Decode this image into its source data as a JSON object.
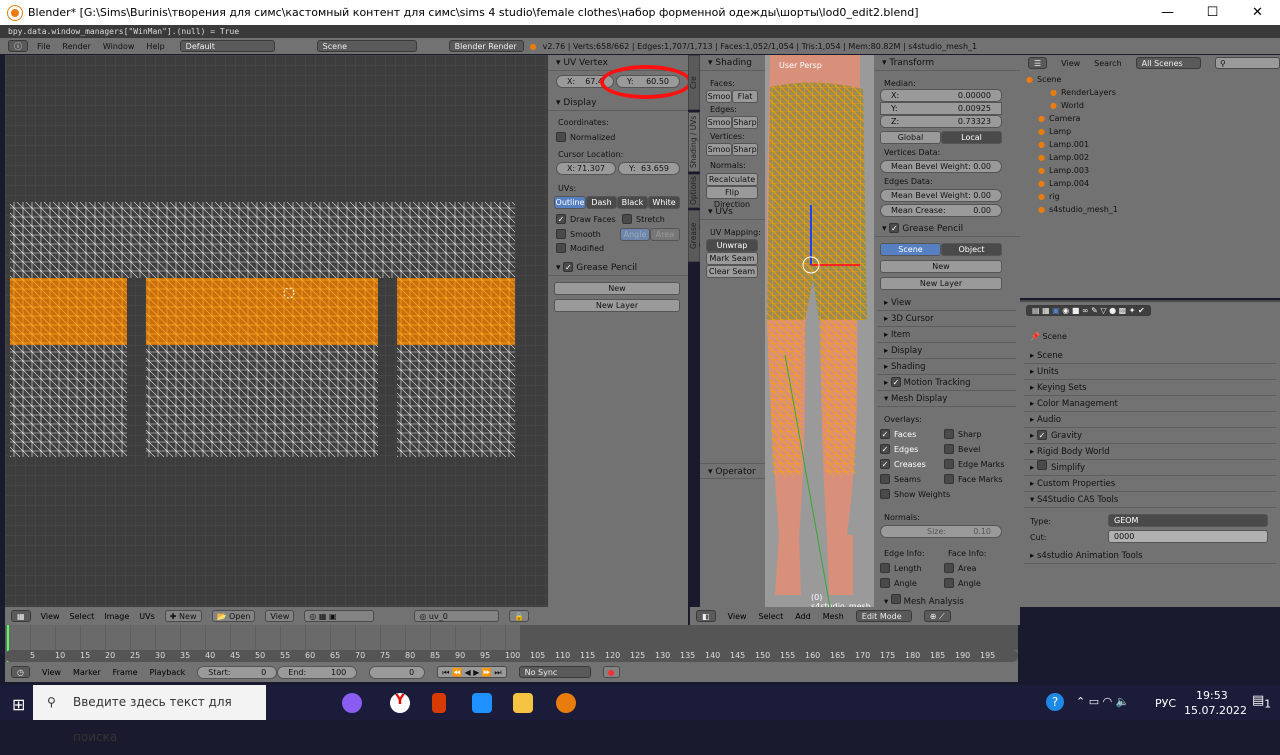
{
  "window": {
    "title": "Blender* [G:\\Sims\\Burinis\\творения для симс\\кастомный контент для симс\\sims 4 studio\\female clothes\\набор форменной одежды\\шорты\\lod0_edit2.blend]",
    "minimize": "—",
    "maximize": "☐",
    "close": "✕"
  },
  "console": {
    "line": "bpy.data.window_managers[\"WinMan\"].(null) = True"
  },
  "topbar": {
    "menus": [
      "File",
      "Render",
      "Window",
      "Help"
    ],
    "layout": "Default",
    "scene": "Scene",
    "engine": "Blender Render",
    "stats": "v2.76 | Verts:658/662 | Edges:1,707/1,713 | Faces:1,052/1,054 | Tris:1,054 | Mem:80.82M | s4studio_mesh_1"
  },
  "uv_panel": {
    "uv_vertex": {
      "title": "UV Vertex",
      "x_label": "X:",
      "x_value": "67.4",
      "y_label": "Y:",
      "y_value": "60.50"
    },
    "display": {
      "title": "Display",
      "coordinates": "Coordinates:",
      "normalized": "Normalized",
      "cursor_location": "Cursor Location:",
      "cursor_x_label": "X:",
      "cursor_x": "71.307",
      "cursor_y_label": "Y:",
      "cursor_y": "63.659",
      "uvs": "UVs:",
      "uv_modes": [
        "Outline",
        "Dash",
        "Black",
        "White"
      ],
      "draw_faces": "Draw Faces",
      "stretch": "Stretch",
      "smooth": "Smooth",
      "angle": "Angle",
      "area": "Area",
      "modified": "Modified"
    },
    "grease_pencil": {
      "title": "Grease Pencil",
      "new": "New",
      "new_layer": "New Layer"
    }
  },
  "tool_tabs": [
    "Grease Pencil",
    "Options",
    "Shading / UVs",
    "Grease Pencil",
    "Tools"
  ],
  "tool_tab_visible": [
    "Grease Pencil",
    "Options",
    "Shading / UVs",
    "Cre"
  ],
  "tool_shelf": {
    "shading": "Shading",
    "faces": "Faces:",
    "edges": "Edges:",
    "vertices": "Vertices:",
    "smooth": "Smoo",
    "flat": "Flat",
    "sharp": "Sharp",
    "normals": "Normals:",
    "recalculate": "Recalculate",
    "flip": "Flip Direction",
    "uvs": "UVs",
    "uv_mapping": "UV Mapping:",
    "unwrap": "Unwrap",
    "mark_seam": "Mark Seam",
    "clear_seam": "Clear Seam",
    "operator": "Operator"
  },
  "viewport": {
    "label": "User Persp",
    "object": "(0) s4studio_mesh"
  },
  "n_panel": {
    "transform": "Transform",
    "median": "Median:",
    "x": "X:",
    "x_val": "0.00000",
    "y": "Y:",
    "y_val": "0.00925",
    "z": "Z:",
    "z_val": "0.73323",
    "global": "Global",
    "local": "Local",
    "vertices_data": "Vertices Data:",
    "mean_bevel": "Mean Bevel Weight:",
    "mean_bevel_v": "0.00",
    "edges_data": "Edges Data:",
    "mean_bevel_e": "0.00",
    "mean_crease": "Mean Crease:",
    "mean_crease_v": "0.00",
    "grease_pencil": "Grease Pencil",
    "scene": "Scene",
    "object": "Object",
    "new": "New",
    "new_layer": "New Layer",
    "collapsed": [
      "View",
      "3D Cursor",
      "Item",
      "Display",
      "Shading"
    ],
    "motion_tracking": "Motion Tracking",
    "mesh_display": "Mesh Display",
    "overlays": "Overlays:",
    "overlay_items": [
      {
        "label": "Faces",
        "checked": true
      },
      {
        "label": "Sharp",
        "checked": false
      },
      {
        "label": "Edges",
        "checked": true
      },
      {
        "label": "Bevel",
        "checked": false
      },
      {
        "label": "Creases",
        "checked": true
      },
      {
        "label": "Edge Marks",
        "checked": false
      },
      {
        "label": "Seams",
        "checked": false
      },
      {
        "label": "Face Marks",
        "checked": false
      }
    ],
    "show_weights": "Show Weights",
    "normals": "Normals:",
    "size": "Size:",
    "size_val": "0.10",
    "edge_info": "Edge Info:",
    "face_info": "Face Info:",
    "length": "Length",
    "angle": "Angle",
    "area": "Area",
    "face_angle": "Angle",
    "mesh_analysis": "Mesh Analysis"
  },
  "outliner": {
    "view": "View",
    "search": "Search",
    "filter": "All Scenes",
    "items": [
      {
        "name": "Scene",
        "indent": 0
      },
      {
        "name": "RenderLayers",
        "indent": 2
      },
      {
        "name": "World",
        "indent": 2
      },
      {
        "name": "Camera",
        "indent": 1
      },
      {
        "name": "Lamp",
        "indent": 1
      },
      {
        "name": "Lamp.001",
        "indent": 1
      },
      {
        "name": "Lamp.002",
        "indent": 1
      },
      {
        "name": "Lamp.003",
        "indent": 1
      },
      {
        "name": "Lamp.004",
        "indent": 1
      },
      {
        "name": "rig",
        "indent": 1
      },
      {
        "name": "s4studio_mesh_1",
        "indent": 1
      }
    ]
  },
  "properties": {
    "context": "Scene",
    "panels": [
      "Scene",
      "Units",
      "Keying Sets",
      "Color Management",
      "Audio",
      "Gravity",
      "Rigid Body World",
      "Simplify",
      "Custom Properties"
    ],
    "gravity_checked": true,
    "simplify_checked": false,
    "cas_tools": "S4Studio CAS Tools",
    "type_label": "Type:",
    "type_value": "GEOM",
    "cut_label": "Cut:",
    "cut_value": "0000",
    "anim_tools": "s4studio Animation Tools"
  },
  "uv_header": {
    "menus": [
      "View",
      "Select",
      "Image",
      "UVs"
    ],
    "new": "New",
    "open": "Open",
    "view": "View",
    "uv_map": "uv_0"
  },
  "view3d_header": {
    "menus": [
      "View",
      "Select",
      "Add",
      "Mesh"
    ],
    "mode": "Edit Mode"
  },
  "timeline": {
    "ticks": [
      "5",
      "10",
      "15",
      "20",
      "25",
      "30",
      "35",
      "40",
      "45",
      "50",
      "55",
      "60",
      "65",
      "70",
      "75",
      "80",
      "85",
      "90",
      "95",
      "100",
      "105",
      "110",
      "115",
      "120",
      "125",
      "130",
      "135",
      "140",
      "145",
      "150",
      "155",
      "160",
      "165",
      "170",
      "175",
      "180",
      "185",
      "190",
      "195"
    ],
    "menus": [
      "View",
      "Marker",
      "Frame",
      "Playback"
    ],
    "start_label": "Start:",
    "start": "0",
    "end_label": "End:",
    "end": "100",
    "current": "0",
    "sync": "No Sync"
  },
  "taskbar": {
    "search_placeholder": "Введите здесь текст для поиска",
    "lang": "РУС",
    "time": "19:53",
    "date": "15.07.2022",
    "notifications": "1"
  },
  "colors": {
    "accent": "#5680c2",
    "selection": "#e88a00",
    "annotation": "#ff0000"
  }
}
